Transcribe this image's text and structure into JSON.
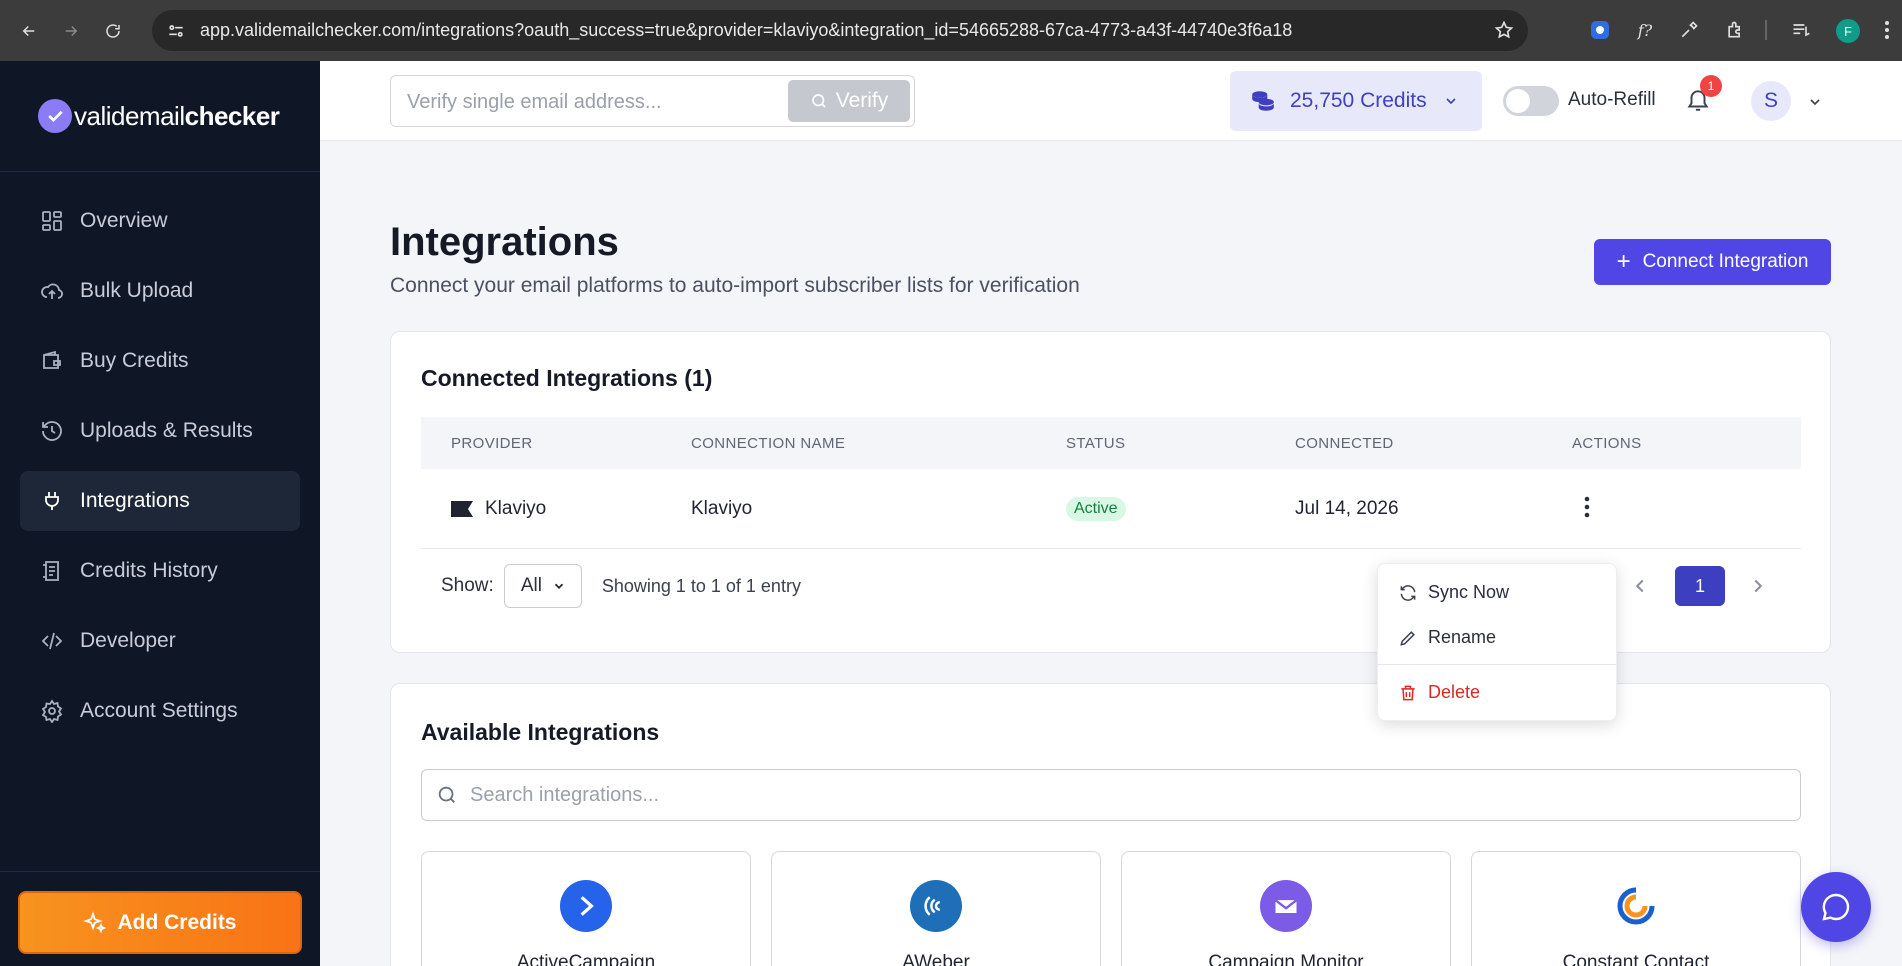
{
  "browser": {
    "url": "app.validemailchecker.com/integrations?oauth_success=true&provider=klaviyo&integration_id=54665288-67ca-4773-a43f-44740e3f6a18",
    "profile_initial": "F"
  },
  "sidebar": {
    "logo_prefix": "validemail",
    "logo_suffix": "checker",
    "items": [
      {
        "label": "Overview",
        "icon": "grid-icon"
      },
      {
        "label": "Bulk Upload",
        "icon": "cloud-upload-icon"
      },
      {
        "label": "Buy Credits",
        "icon": "wallet-icon"
      },
      {
        "label": "Uploads & Results",
        "icon": "history-icon"
      },
      {
        "label": "Integrations",
        "icon": "plug-icon",
        "active": true
      },
      {
        "label": "Credits History",
        "icon": "receipt-icon"
      },
      {
        "label": "Developer",
        "icon": "code-icon"
      },
      {
        "label": "Account Settings",
        "icon": "gear-icon"
      }
    ],
    "add_credits_label": "Add Credits"
  },
  "header": {
    "verify_placeholder": "Verify single email address...",
    "verify_label": "Verify",
    "credits_label": "25,750 Credits",
    "auto_refill_label": "Auto-Refill",
    "notification_count": "1",
    "avatar_initial": "S"
  },
  "main": {
    "title": "Integrations",
    "subtitle": "Connect your email platforms to auto-import subscriber lists for verification",
    "connect_button": "Connect Integration",
    "connected": {
      "title": "Connected Integrations (1)",
      "columns": [
        "PROVIDER",
        "CONNECTION NAME",
        "STATUS",
        "CONNECTED",
        "ACTIONS"
      ],
      "rows": [
        {
          "provider": "Klaviyo",
          "connection_name": "Klaviyo",
          "status": "Active",
          "connected": "Jul 14, 2026"
        }
      ],
      "show_label": "Show:",
      "show_value": "All",
      "showing_text": "Showing 1 to 1 of 1 entry",
      "current_page": "1"
    },
    "actions_menu": {
      "sync": "Sync Now",
      "rename": "Rename",
      "delete": "Delete"
    },
    "available": {
      "title": "Available Integrations",
      "search_placeholder": "Search integrations...",
      "items": [
        {
          "name": "ActiveCampaign",
          "color": "#2563eb"
        },
        {
          "name": "AWeber",
          "color": "#1e6fb8"
        },
        {
          "name": "Campaign Monitor",
          "color": "#7c5ce6"
        },
        {
          "name": "Constant Contact",
          "color": "#1a5fd0"
        }
      ]
    }
  },
  "colors": {
    "accent": "#4f46e5",
    "sidebar_bg": "#0f1726",
    "active_status": "#15803d",
    "delete": "#dc2626",
    "add_credits": "#f97316"
  }
}
